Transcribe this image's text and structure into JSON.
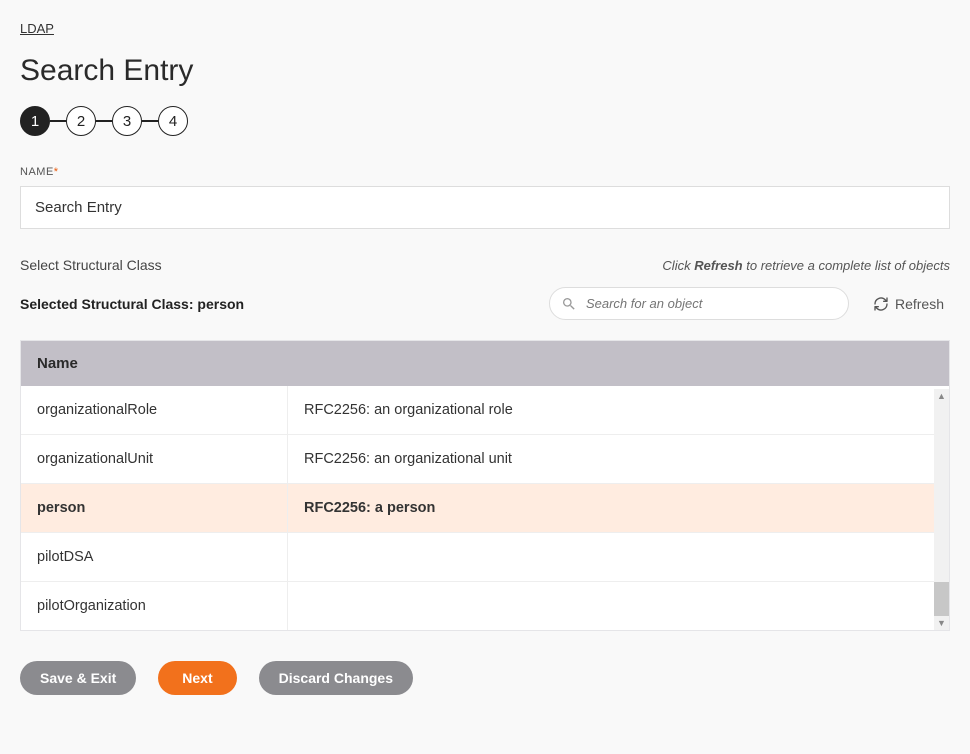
{
  "breadcrumb": {
    "label": "LDAP"
  },
  "page_title": "Search Entry",
  "stepper": {
    "steps": [
      "1",
      "2",
      "3",
      "4"
    ],
    "active_index": 0
  },
  "name_field": {
    "label": "NAME",
    "required_mark": "*",
    "value": "Search Entry"
  },
  "structural": {
    "select_label": "Select Structural Class",
    "hint_prefix": "Click ",
    "hint_bold": "Refresh",
    "hint_suffix": " to retrieve a complete list of objects",
    "selected_prefix": "Selected Structural Class: ",
    "selected_value": "person",
    "search_placeholder": "Search for an object",
    "refresh_label": "Refresh"
  },
  "table": {
    "header_name": "Name",
    "rows": [
      {
        "name": "organizationalRole",
        "desc": "RFC2256: an organizational role",
        "selected": false
      },
      {
        "name": "organizationalUnit",
        "desc": "RFC2256: an organizational unit",
        "selected": false
      },
      {
        "name": "person",
        "desc": "RFC2256: a person",
        "selected": true
      },
      {
        "name": "pilotDSA",
        "desc": "",
        "selected": false
      },
      {
        "name": "pilotOrganization",
        "desc": "",
        "selected": false
      }
    ]
  },
  "buttons": {
    "save_exit": "Save & Exit",
    "next": "Next",
    "discard": "Discard Changes"
  }
}
